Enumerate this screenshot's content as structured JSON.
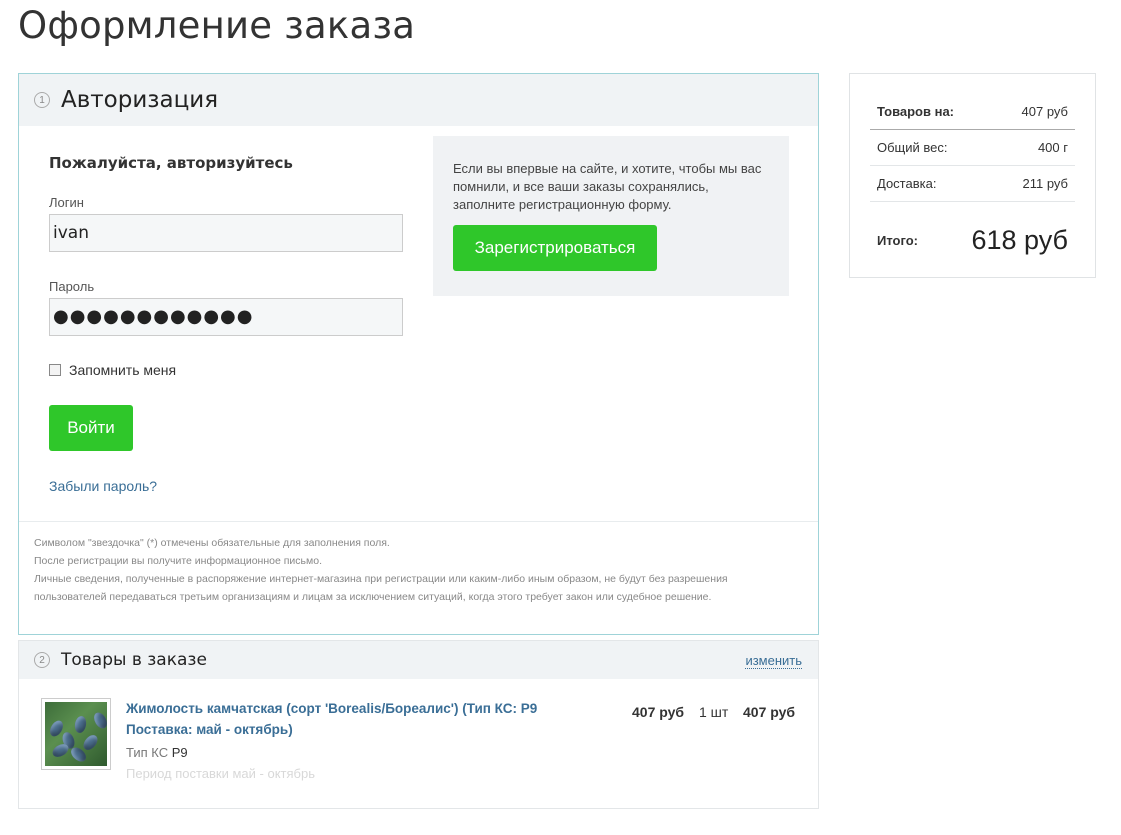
{
  "page": {
    "title": "Оформление заказа"
  },
  "auth": {
    "step": "1",
    "title": "Авторизация",
    "heading": "Пожалуйста, авторизуйтесь",
    "login_label": "Логин",
    "login_value": "ivan",
    "password_label": "Пароль",
    "password_value": "●●●●●●●●●●●●",
    "remember_label": "Запомнить меня",
    "remember_checked": false,
    "login_button": "Войти",
    "forgot_link": "Забыли пароль?",
    "register_text": "Если вы впервые на сайте, и хотите, чтобы мы вас помнили, и все ваши заказы сохранялись, заполните регистрационную форму.",
    "register_button": "Зарегистрироваться",
    "footer": {
      "line1": "Символом \"звездочка\" (*) отмечены обязательные для заполнения поля.",
      "line2": "После регистрации вы получите информационное письмо.",
      "line3": "Личные сведения, полученные в распоряжение интернет-магазина при регистрации или каким-либо иным образом, не будут без разрешения",
      "line4": "пользователей передаваться третьим организациям и лицам за исключением ситуаций, когда этого требует закон или судебное решение."
    }
  },
  "items": {
    "step": "2",
    "title": "Товары в заказе",
    "change_link": "изменить",
    "product": {
      "name": "Жимолость камчатская (сорт 'Borealis/Бореалис') (Тип КС: Р9 Поставка: май - октябрь)",
      "prop_label": "Тип КС",
      "prop_value": "Р9",
      "prop2": "Период поставки май - октябрь",
      "price": "407 руб",
      "qty": "1 шт",
      "sum": "407 руб"
    }
  },
  "summary": {
    "goods_label": "Товаров на:",
    "goods_value": "407 руб",
    "weight_label": "Общий вес:",
    "weight_value": "400 г",
    "delivery_label": "Доставка:",
    "delivery_value": "211 руб",
    "total_label": "Итого:",
    "total_value": "618 руб"
  },
  "colors": {
    "accent_green": "#2fc72a",
    "link_blue": "#3a6e96",
    "section_border": "#9fd3d8"
  }
}
